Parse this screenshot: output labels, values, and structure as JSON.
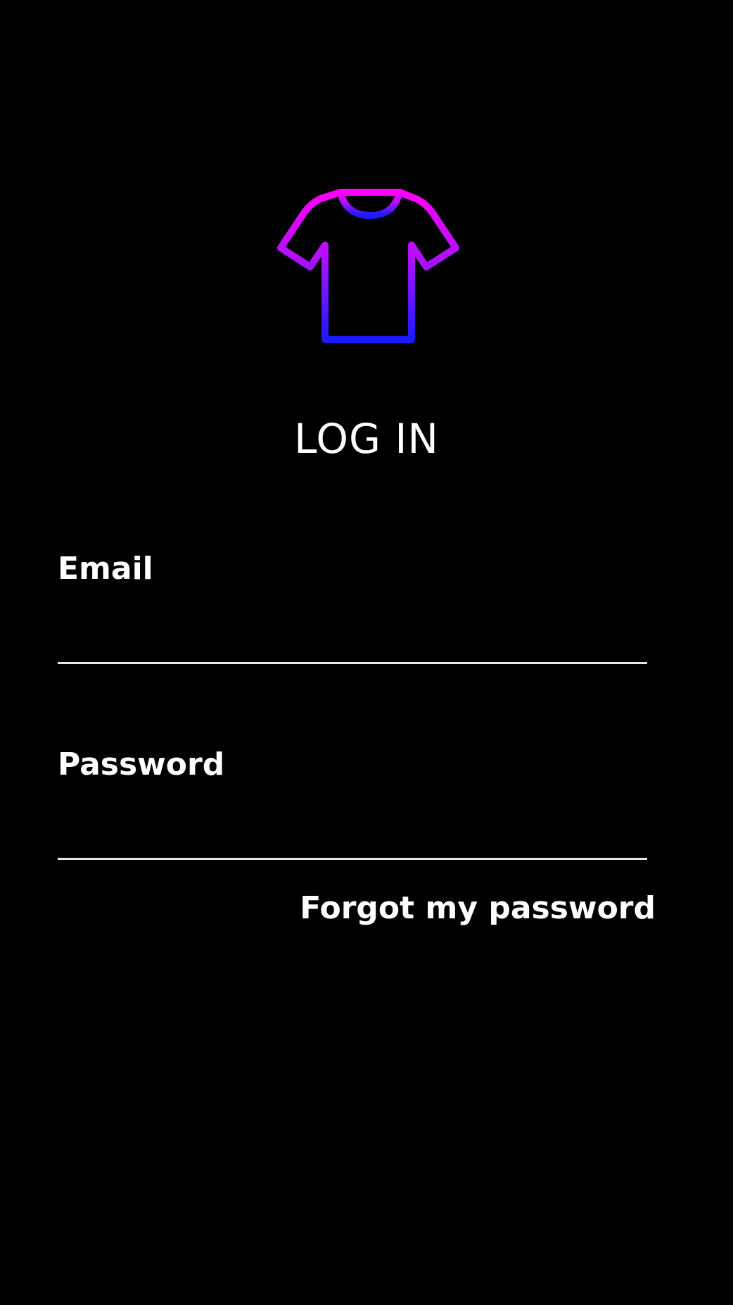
{
  "logo": {
    "icon": "tshirt-icon",
    "gradient_top": "#ff00ff",
    "gradient_bottom": "#1a1aff"
  },
  "title": "LOG IN",
  "email": {
    "label": "Email",
    "value": "",
    "placeholder": ""
  },
  "password": {
    "label": "Password",
    "value": "",
    "placeholder": ""
  },
  "forgot_link": "Forgot my password",
  "colors": {
    "background": "#000000",
    "text": "#ffffff",
    "underline": "#e8e8e8"
  }
}
